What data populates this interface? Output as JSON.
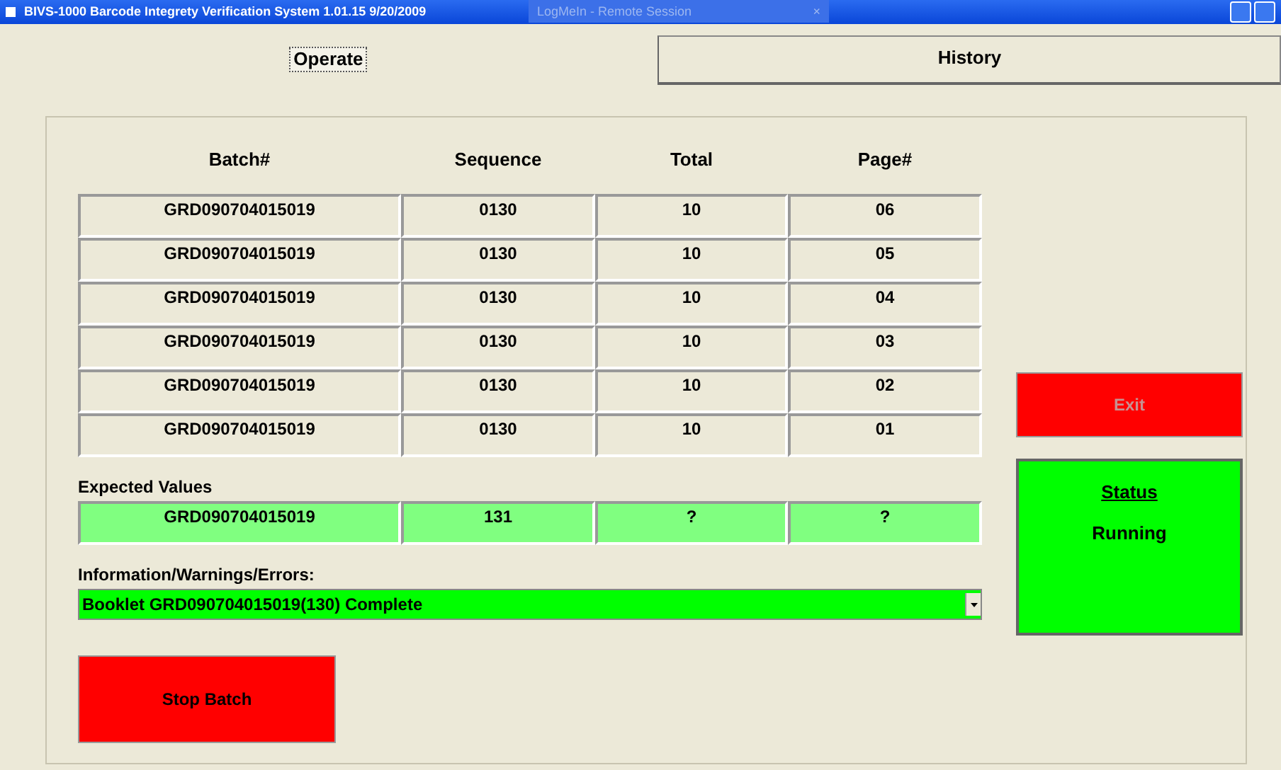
{
  "window": {
    "title": "BIVS-1000 Barcode Integrety Verification System 1.01.15 9/20/2009",
    "overlay_title": "LogMeIn - Remote Session",
    "overlay_close": "×"
  },
  "tabs": [
    {
      "label": "Operate",
      "selected": true
    },
    {
      "label": "History",
      "selected": false
    }
  ],
  "table": {
    "columns": [
      "Batch#",
      "Sequence",
      "Total",
      "Page#"
    ],
    "rows": [
      [
        "GRD090704015019",
        "0130",
        "10",
        "06"
      ],
      [
        "GRD090704015019",
        "0130",
        "10",
        "05"
      ],
      [
        "GRD090704015019",
        "0130",
        "10",
        "04"
      ],
      [
        "GRD090704015019",
        "0130",
        "10",
        "03"
      ],
      [
        "GRD090704015019",
        "0130",
        "10",
        "02"
      ],
      [
        "GRD090704015019",
        "0130",
        "10",
        "01"
      ]
    ]
  },
  "expected": {
    "label": "Expected Values",
    "values": [
      "GRD090704015019",
      "131",
      "?",
      "?"
    ]
  },
  "messages": {
    "label": "Information/Warnings/Errors:",
    "value": "Booklet GRD090704015019(130) Complete"
  },
  "stop_button": {
    "label": "Stop Batch"
  },
  "exit_button": {
    "label": "Exit",
    "disabled": true
  },
  "status": {
    "title": "Status",
    "value": "Running"
  }
}
